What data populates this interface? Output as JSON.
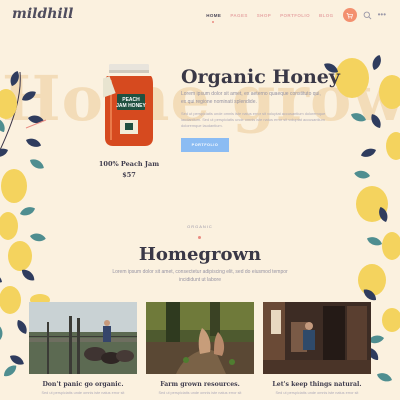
{
  "brand": {
    "logo": "mildhill"
  },
  "nav": {
    "items": [
      {
        "label": "HOME",
        "active": true
      },
      {
        "label": "PAGES",
        "active": false
      },
      {
        "label": "SHOP",
        "active": false
      },
      {
        "label": "PORTFOLIO",
        "active": false
      },
      {
        "label": "BLOG",
        "active": false
      }
    ],
    "icons": [
      "cart-icon",
      "search-icon",
      "more-icon"
    ]
  },
  "background_words": [
    "Home",
    "grown"
  ],
  "product": {
    "jar_label_line1": "PEACH",
    "jar_label_line2": "JAM HONEY",
    "name": "100% Peach Jam",
    "price": "$57"
  },
  "hero": {
    "title": "Organic Honey",
    "lead": "Lorem ipsum dolor sit amet, ex aeterno quaeque constituto qui, ex qui regione nominati splendide.",
    "body": "Sed ut perspiciatis unde omnis iste natus error sit voluptat accusantium doloremque laudantium. Sed ut perspiciatis unde omnis iste natus error sit voluptat accusantium doloremque laudantium.",
    "button": "PORTFOLIO"
  },
  "section": {
    "eyebrow": "ORGANIC",
    "title": "Homegrown",
    "lead": "Lorem ipsum dolor sit amet, consectetur adipiscing elit, sed do eiusmod tempor incididunt ut labore"
  },
  "cards": [
    {
      "title": "Don't panic go organic.",
      "desc": "Sed ut perspiciatis unde omnis iste natus error sit"
    },
    {
      "title": "Farm grown resources.",
      "desc": "Sed ut perspiciatis unde omnis iste natus error sit"
    },
    {
      "title": "Let's keep things natural.",
      "desc": "Sed ut perspiciatis unde omnis iste natus error sit"
    }
  ],
  "colors": {
    "background": "#fbf1df",
    "accent": "#f3906f",
    "button": "#8bbcf3",
    "heading": "#3a3847",
    "lemon": "#f4d35e",
    "leaf": "#2f3c5e"
  }
}
